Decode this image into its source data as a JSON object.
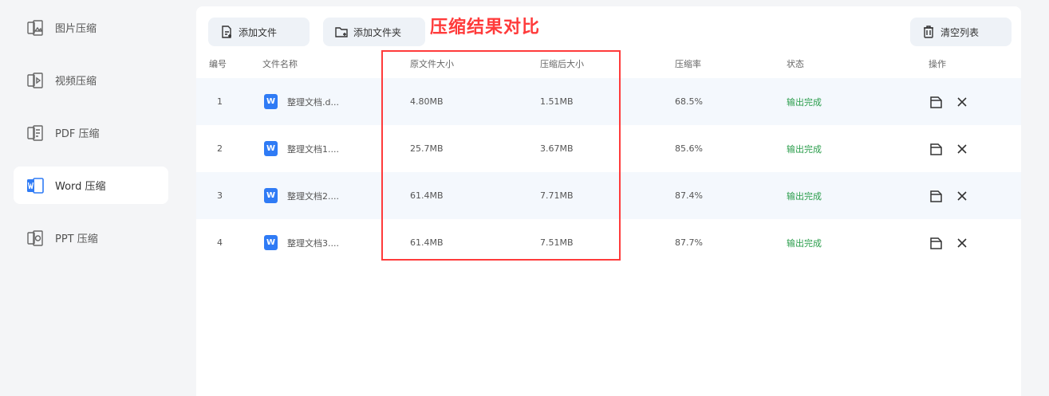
{
  "sidebar": {
    "items": [
      {
        "label": "图片压缩",
        "icon": "image-compress-icon"
      },
      {
        "label": "视频压缩",
        "icon": "video-compress-icon"
      },
      {
        "label": "PDF 压缩",
        "icon": "pdf-compress-icon"
      },
      {
        "label": "Word 压缩",
        "icon": "word-compress-icon",
        "active": true
      },
      {
        "label": "PPT 压缩",
        "icon": "ppt-compress-icon"
      }
    ]
  },
  "toolbar": {
    "add_file_label": "添加文件",
    "add_folder_label": "添加文件夹",
    "clear_list_label": "清空列表"
  },
  "annotation": "压缩结果对比",
  "table": {
    "headers": [
      "编号",
      "文件名称",
      "原文件大小",
      "压缩后大小",
      "压缩率",
      "状态",
      "操作"
    ],
    "rows": [
      {
        "index": "1",
        "name": "整理文档.d...",
        "original": "4.80MB",
        "compressed": "1.51MB",
        "ratio": "68.5%",
        "status": "输出完成"
      },
      {
        "index": "2",
        "name": "整理文档1....",
        "original": "25.7MB",
        "compressed": "3.67MB",
        "ratio": "85.6%",
        "status": "输出完成"
      },
      {
        "index": "3",
        "name": "整理文档2....",
        "original": "61.4MB",
        "compressed": "7.71MB",
        "ratio": "87.4%",
        "status": "输出完成"
      },
      {
        "index": "4",
        "name": "整理文档3....",
        "original": "61.4MB",
        "compressed": "7.51MB",
        "ratio": "87.7%",
        "status": "输出完成"
      }
    ]
  },
  "colors": {
    "accent": "#2f7bf5",
    "status_done": "#2a9d4b",
    "annotation": "#ff3b3b",
    "row_highlight": "#f4f8fd"
  }
}
